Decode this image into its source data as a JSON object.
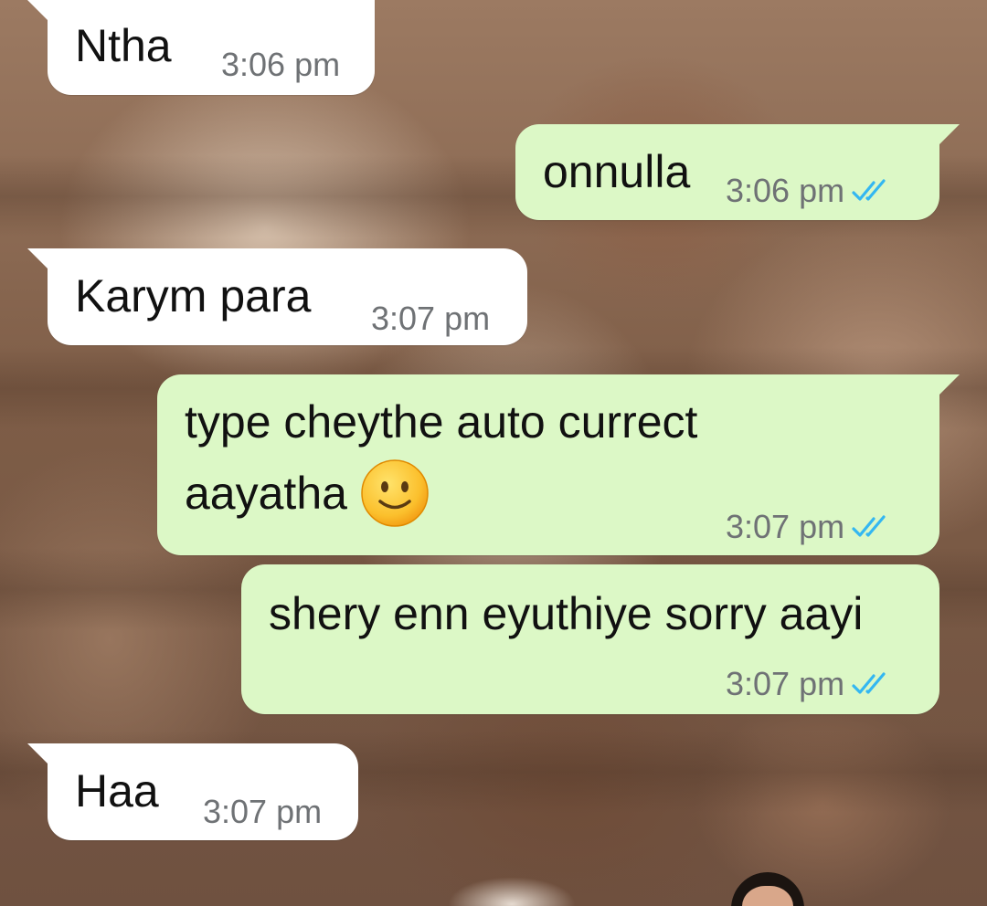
{
  "conversation": {
    "messages": [
      {
        "direction": "incoming",
        "text": "Ntha",
        "time": "3:06 pm"
      },
      {
        "direction": "outgoing",
        "text": "onnulla",
        "time": "3:06 pm",
        "status": "read",
        "status_icon": "double-check-icon",
        "status_color": "#34b7f1"
      },
      {
        "direction": "incoming",
        "text": "Karym para",
        "time": "3:07 pm"
      },
      {
        "direction": "outgoing",
        "line1": "type cheythe auto currect",
        "line2": "aayatha",
        "emoji": "slightly-smiling-face-emoji",
        "time": "3:07 pm",
        "status": "read",
        "status_icon": "double-check-icon",
        "status_color": "#34b7f1"
      },
      {
        "direction": "outgoing",
        "text": "shery enn eyuthiye sorry aayi",
        "time": "3:07 pm",
        "status": "read",
        "status_icon": "double-check-icon",
        "status_color": "#34b7f1"
      },
      {
        "direction": "incoming",
        "text": "Haa",
        "time": "3:07 pm"
      }
    ]
  },
  "colors": {
    "incoming_bubble": "#ffffff",
    "outgoing_bubble": "#dcf8c6",
    "time_text": "#6f7275",
    "read_ticks": "#34b7f1"
  }
}
